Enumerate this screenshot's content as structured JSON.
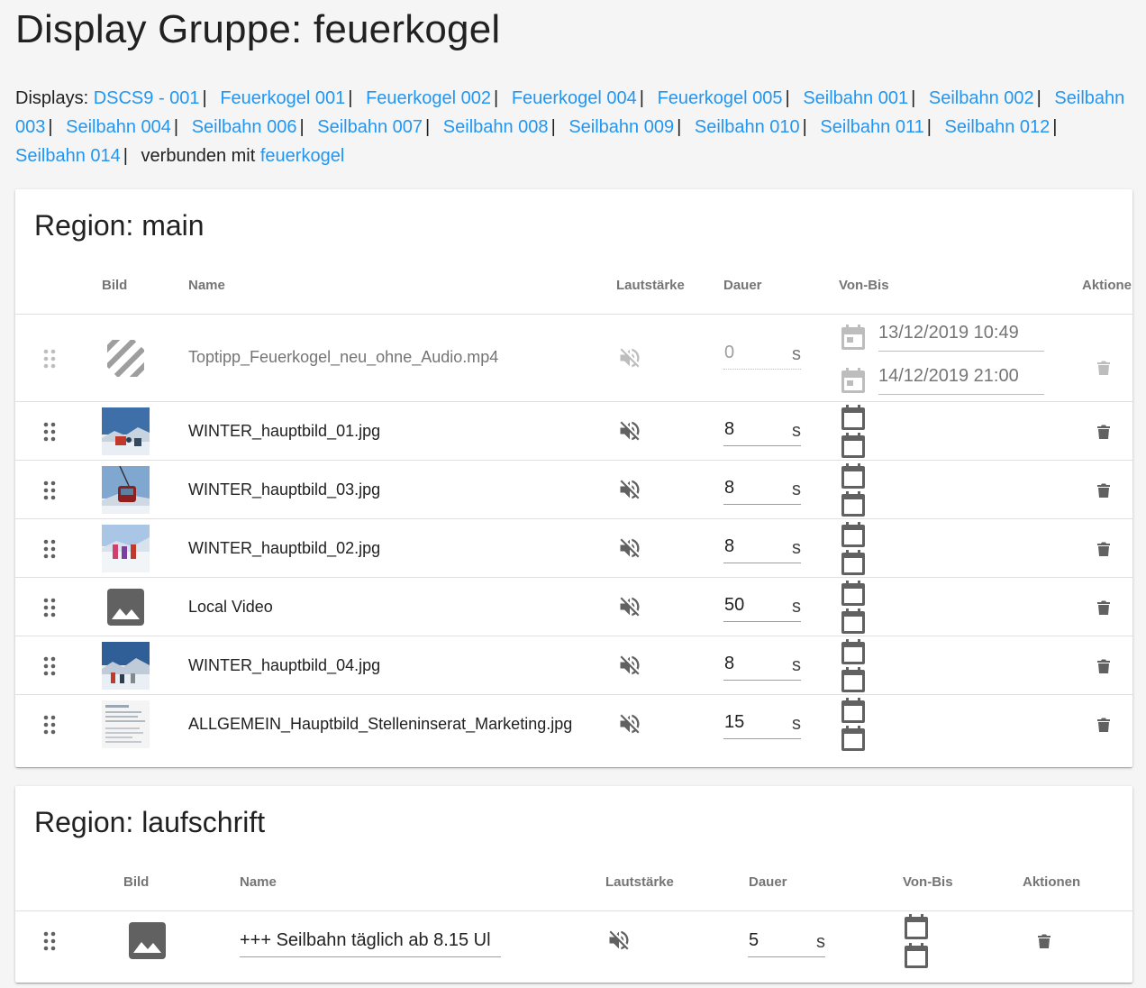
{
  "page": {
    "title": "Display Gruppe: feuerkogel"
  },
  "displays": {
    "label": "Displays:",
    "links": [
      "DSCS9 - 001",
      "Feuerkogel 001",
      "Feuerkogel 002",
      "Feuerkogel 004",
      "Feuerkogel 005",
      "Seilbahn 001",
      "Seilbahn 002",
      "Seilbahn 003",
      "Seilbahn 004",
      "Seilbahn 006",
      "Seilbahn 007",
      "Seilbahn 008",
      "Seilbahn 009",
      "Seilbahn 010",
      "Seilbahn 011",
      "Seilbahn 012",
      "Seilbahn 014"
    ],
    "separator": "|",
    "connected_prefix": "verbunden mit",
    "connected_link": "feuerkogel"
  },
  "colors": {
    "link": "#2196f3",
    "icon": "#616161",
    "icon_disabled": "#bdbdbd"
  },
  "regions": {
    "main": {
      "title": "Region: main",
      "headers": {
        "bild": "Bild",
        "name": "Name",
        "lautstaerke": "Lautstärke",
        "dauer": "Dauer",
        "vonbis": "Von-Bis",
        "aktionen": "Aktione"
      },
      "rows": [
        {
          "thumb": "video-striped-icon",
          "name": "Toptipp_Feuerkogel_neu_ohne_Audio.mp4",
          "duration": "0",
          "unit": "s",
          "from": "13/12/2019  10:49",
          "to": "14/12/2019  21:00",
          "disabled": true
        },
        {
          "thumb": "winter-photo-chairlift",
          "name": "WINTER_hauptbild_01.jpg",
          "duration": "8",
          "unit": "s"
        },
        {
          "thumb": "winter-photo-gondola",
          "name": "WINTER_hauptbild_03.jpg",
          "duration": "8",
          "unit": "s"
        },
        {
          "thumb": "winter-photo-hikers",
          "name": "WINTER_hauptbild_02.jpg",
          "duration": "8",
          "unit": "s"
        },
        {
          "thumb": "image-placeholder-icon",
          "name": "Local Video",
          "duration": "50",
          "unit": "s"
        },
        {
          "thumb": "winter-photo-skiers",
          "name": "WINTER_hauptbild_04.jpg",
          "duration": "8",
          "unit": "s"
        },
        {
          "thumb": "document-photo",
          "name": "ALLGEMEIN_Hauptbild_Stelleninserat_Marketing.jpg",
          "duration": "15",
          "unit": "s"
        }
      ]
    },
    "laufschrift": {
      "title": "Region: laufschrift",
      "headers": {
        "bild": "Bild",
        "name": "Name",
        "lautstaerke": "Lautstärke",
        "dauer": "Dauer",
        "vonbis": "Von-Bis",
        "aktionen": "Aktionen"
      },
      "rows": [
        {
          "thumb": "image-placeholder-icon",
          "name": "+++ Seilbahn täglich ab 8.15 Ul",
          "duration": "5",
          "unit": "s"
        }
      ]
    }
  }
}
